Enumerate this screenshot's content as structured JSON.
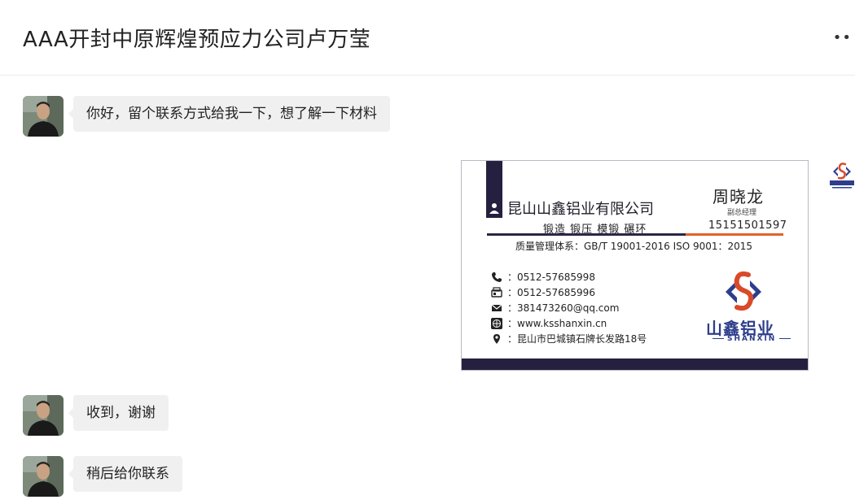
{
  "header": {
    "title": "AAA开封中原辉煌预应力公司卢万莹",
    "more_label": "••"
  },
  "messages": [
    {
      "text": "你好，留个联系方式给我一下，想了解一下材料"
    },
    {
      "text": "收到，谢谢"
    },
    {
      "text": "稍后给你联系"
    }
  ],
  "card": {
    "company": "昆山山鑫铝业有限公司",
    "services": "锻造 锻压 模锻 碾环",
    "quality": "质量管理体系：GB/T 19001-2016  ISO 9001：2015",
    "name": "周晓龙",
    "position": "副总经理",
    "mobile": "15151501597",
    "phone": "：0512-57685998",
    "fax": "：0512-57685996",
    "email": "：381473260@qq.com",
    "website": "：www.ksshanxin.cn",
    "address": "：昆山市巴城镇石牌长发路18号",
    "logo_cn": "山鑫铝业",
    "logo_en": "SHANXIN"
  },
  "colors": {
    "navy": "#25203f",
    "orange": "#e2612a",
    "logo_blue": "#2e3e8c",
    "logo_red": "#d94a2a"
  },
  "icons": [
    "more-icon",
    "phone-icon",
    "fax-icon",
    "mail-icon",
    "globe-icon",
    "location-icon",
    "person-icon"
  ]
}
